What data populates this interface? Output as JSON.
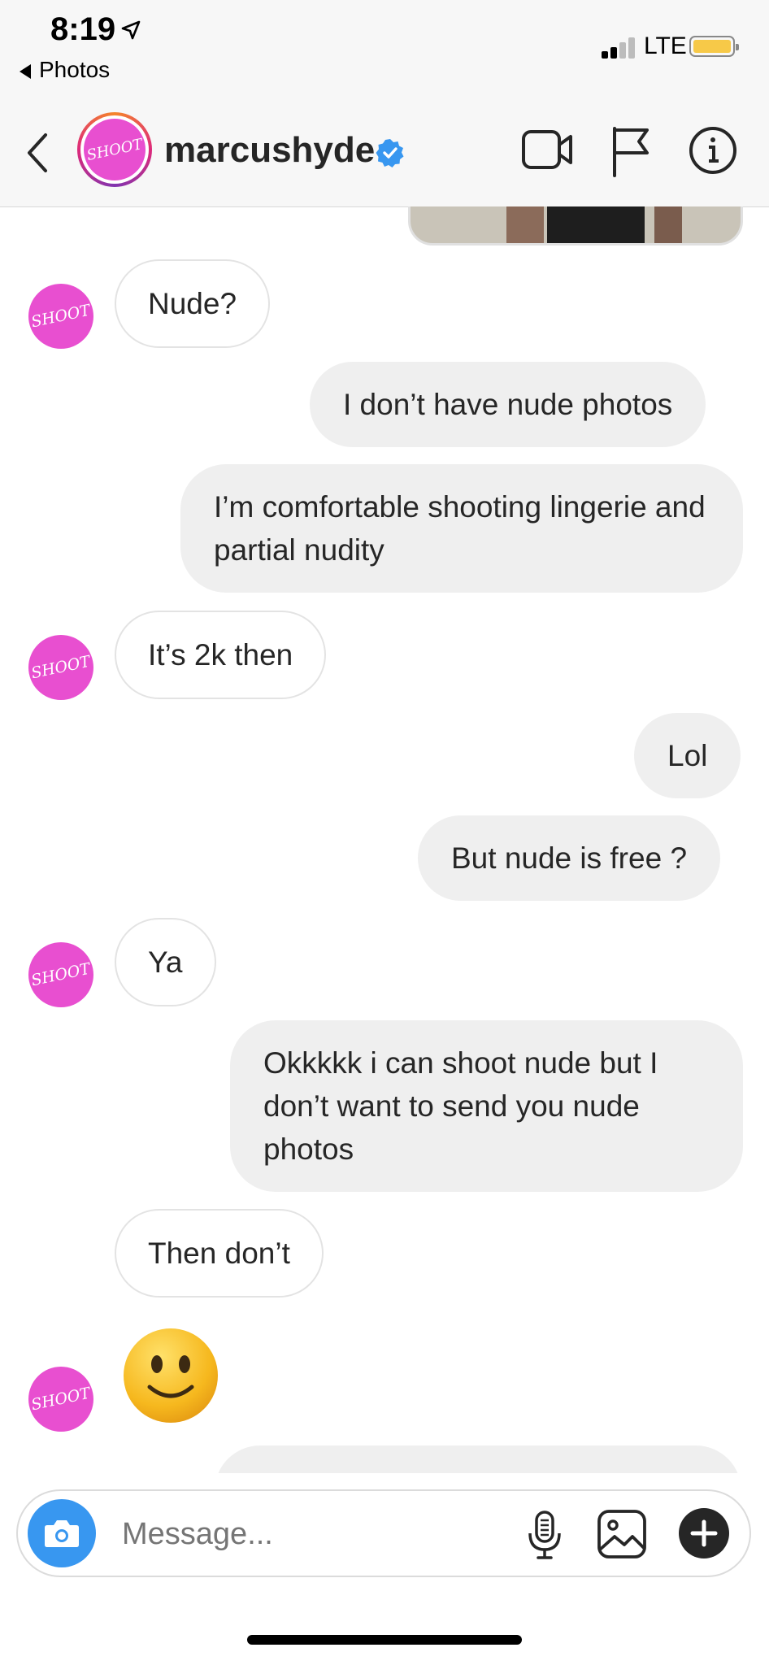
{
  "status_bar": {
    "time": "8:19",
    "back_app": "Photos",
    "network": "LTE",
    "battery_color": "#f7c948"
  },
  "header": {
    "username": "marcushyde",
    "avatar_text": "SHOOT",
    "verified_badge_color": "#3897f0",
    "icons": [
      "back-chevron-icon",
      "video-call-icon",
      "flag-icon",
      "info-icon"
    ]
  },
  "messages": [
    {
      "side": "in",
      "text": "Nude?",
      "avatar_text": "SHOOT"
    },
    {
      "side": "out",
      "text": "I don’t have nude photos"
    },
    {
      "side": "out",
      "text": "I’m comfortable shooting lingerie and partial nudity"
    },
    {
      "side": "in",
      "text": "It’s 2k then",
      "avatar_text": "SHOOT"
    },
    {
      "side": "out",
      "text": "Lol"
    },
    {
      "side": "out",
      "text": "But nude is free ?"
    },
    {
      "side": "in",
      "text": "Ya",
      "avatar_text": "SHOOT"
    },
    {
      "side": "out",
      "text": "Okkkkk i can shoot nude but I don’t want to send you nude photos"
    },
    {
      "side": "in",
      "text": "Then don’t"
    },
    {
      "side": "in",
      "emoji": "slightly-smiling-face",
      "avatar_text": "SHOOT"
    }
  ],
  "composer": {
    "placeholder": "Message...",
    "icons": [
      "camera-icon",
      "microphone-icon",
      "gallery-icon",
      "plus-icon"
    ]
  },
  "colors": {
    "accent_blue": "#3897f0",
    "avatar_pink": "#e84fd0",
    "outgoing_bubble": "#efefef"
  }
}
